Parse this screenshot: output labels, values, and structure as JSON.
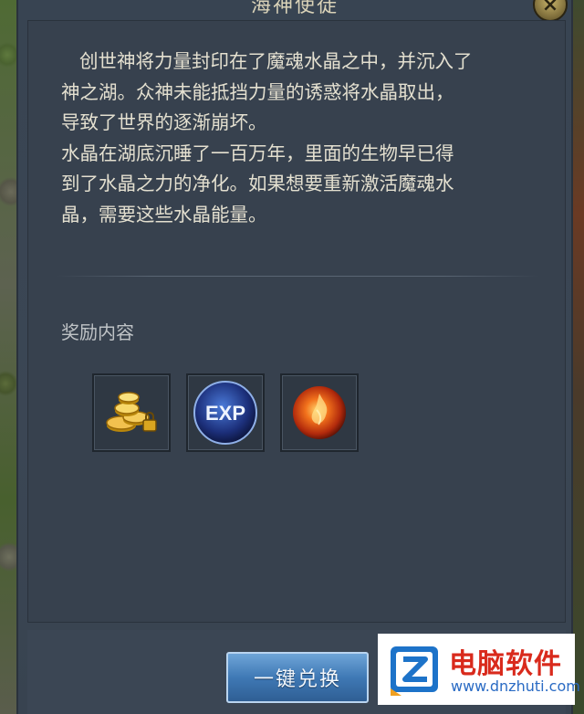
{
  "window": {
    "title": "海神使徒",
    "close_label": "×"
  },
  "description": {
    "paragraphs": [
      [
        "创世神将力量封印在了魔魂水晶之中，并沉入了",
        "神之湖。众神未能抵挡力量的诱惑将水晶取出，",
        "导致了世界的逐渐崩坏。"
      ],
      [
        "水晶在湖底沉睡了一百万年，里面的生物早已得",
        "到了水晶之力的净化。如果想要重新激活魔魂水",
        "晶，需要这些水晶能量。"
      ]
    ]
  },
  "rewards": {
    "heading": "奖励内容",
    "items": [
      {
        "icon": "gold-coins-icon"
      },
      {
        "icon": "exp-orb-icon",
        "label": "EXP"
      },
      {
        "icon": "fire-crystal-icon"
      }
    ]
  },
  "actions": {
    "exchange_label": "一键兑换"
  },
  "watermark": {
    "name": "电脑软件",
    "url": "www.dnzhuti.com"
  }
}
